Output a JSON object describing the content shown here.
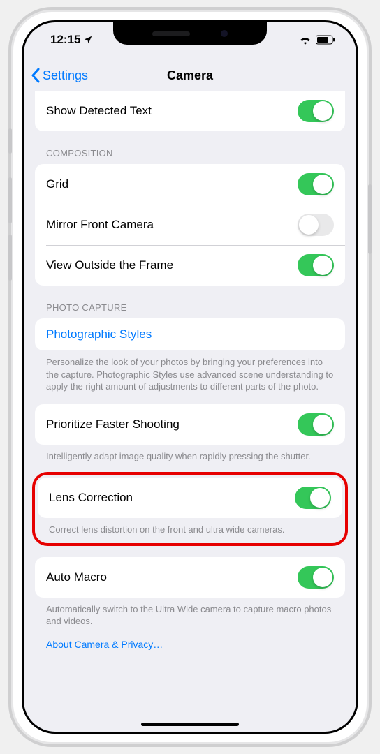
{
  "status": {
    "time": "12:15"
  },
  "nav": {
    "back": "Settings",
    "title": "Camera"
  },
  "section_top": {
    "row_show_detected": {
      "label": "Show Detected Text",
      "on": true
    }
  },
  "section_composition": {
    "header": "COMPOSITION",
    "row_grid": {
      "label": "Grid",
      "on": true
    },
    "row_mirror": {
      "label": "Mirror Front Camera",
      "on": false
    },
    "row_view_outside": {
      "label": "View Outside the Frame",
      "on": true
    }
  },
  "section_photo_capture": {
    "header": "PHOTO CAPTURE",
    "row_styles": {
      "label": "Photographic Styles"
    },
    "styles_footer": "Personalize the look of your photos by bringing your preferences into the capture. Photographic Styles use advanced scene understanding to apply the right amount of adjustments to different parts of the photo.",
    "row_faster": {
      "label": "Prioritize Faster Shooting",
      "on": true
    },
    "faster_footer": "Intelligently adapt image quality when rapidly pressing the shutter.",
    "row_lens": {
      "label": "Lens Correction",
      "on": true
    },
    "lens_footer": "Correct lens distortion on the front and ultra wide cameras.",
    "row_auto_macro": {
      "label": "Auto Macro",
      "on": true
    },
    "auto_macro_footer": "Automatically switch to the Ultra Wide camera to capture macro photos and videos.",
    "about_link": "About Camera & Privacy…"
  }
}
